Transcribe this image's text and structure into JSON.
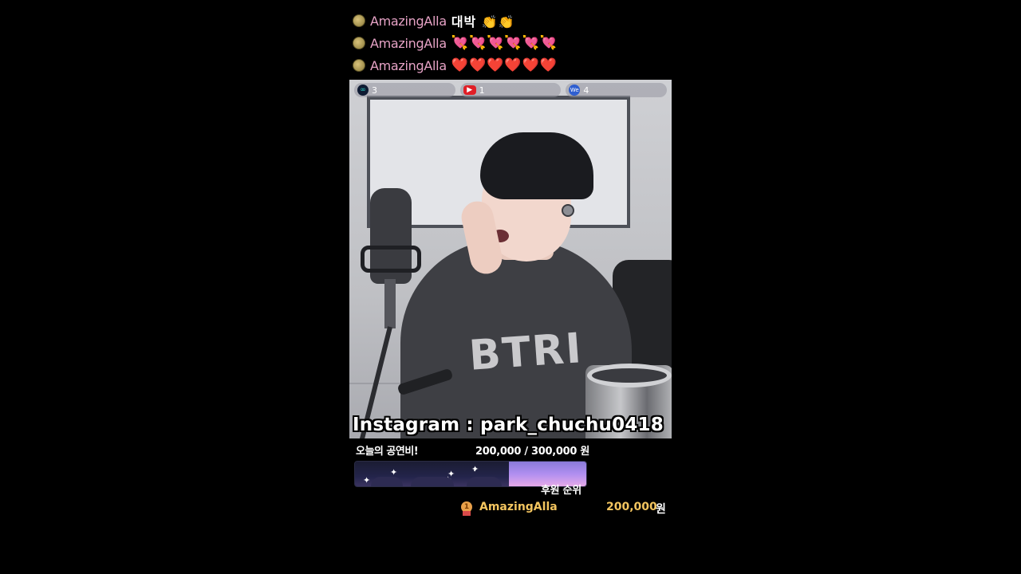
{
  "chat": {
    "messages": [
      {
        "user": "AmazingAlla",
        "message": "대박 👏👏"
      },
      {
        "user": "AmazingAlla",
        "message": "💘💘💘💘💘💘"
      },
      {
        "user": "AmazingAlla",
        "message": "❤️❤️❤️❤️❤️❤️"
      }
    ]
  },
  "video": {
    "stats": [
      {
        "platform_icon": "chzzk-icon",
        "count": "3"
      },
      {
        "platform_icon": "youtube-icon",
        "count": "1"
      },
      {
        "platform_icon": "we-icon",
        "count": "4"
      }
    ],
    "shirt_print": "BTRI",
    "caption": "Instagram : park_chuchu0418"
  },
  "goal": {
    "label": "오늘의 공연비!",
    "amount": "200,000 / 300,000 원",
    "current": 200000,
    "target": 300000,
    "progress_fraction": 0.667
  },
  "ranking": {
    "title": "후원 순위",
    "entries": [
      {
        "rank": "1",
        "name": "AmazingAlla",
        "value": "200,000",
        "unit": "원"
      }
    ]
  },
  "colors": {
    "background": "#000000",
    "chat_username": "#e7a3c6",
    "rank_gold": "#f3c55f"
  }
}
